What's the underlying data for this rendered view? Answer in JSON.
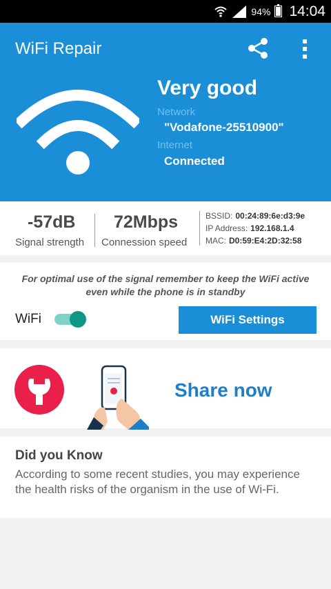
{
  "status_bar": {
    "battery": "94%",
    "time": "14:04"
  },
  "header": {
    "title": "WiFi Repair",
    "quality": "Very good",
    "network_label": "Network",
    "network_value": "\"Vodafone-25510900\"",
    "internet_label": "Internet",
    "internet_value": "Connected",
    "accent_color": "#1b8ed8"
  },
  "stats": {
    "signal_value": "-57dB",
    "signal_label": "Signal strength",
    "speed_value": "72Mbps",
    "speed_label": "Connession speed",
    "bssid_label": "BSSID:",
    "bssid_value": "00:24:89:6e:d3:9e",
    "ip_label": "IP Address:",
    "ip_value": "192.168.1.4",
    "mac_label": "MAC:",
    "mac_value": "D0:59:E4:2D:32:58"
  },
  "wifi_card": {
    "tip_line1": "For optimal use of the signal remember to keep the WiFi active",
    "tip_line2": "even while the phone is in standby",
    "wifi_label": "WiFi",
    "toggle_on": true,
    "settings_button": "WiFi Settings"
  },
  "share_card": {
    "share_label": "Share now"
  },
  "did_you_know": {
    "title": "Did you Know",
    "text": "According to some recent studies, you may experience the health risks of the organism in the use of Wi-Fi."
  },
  "icons": {
    "share": "share-icon",
    "menu": "more-vert-icon",
    "wifi": "wifi-icon",
    "wrench": "wrench-icon",
    "phone": "phone-illustration"
  }
}
